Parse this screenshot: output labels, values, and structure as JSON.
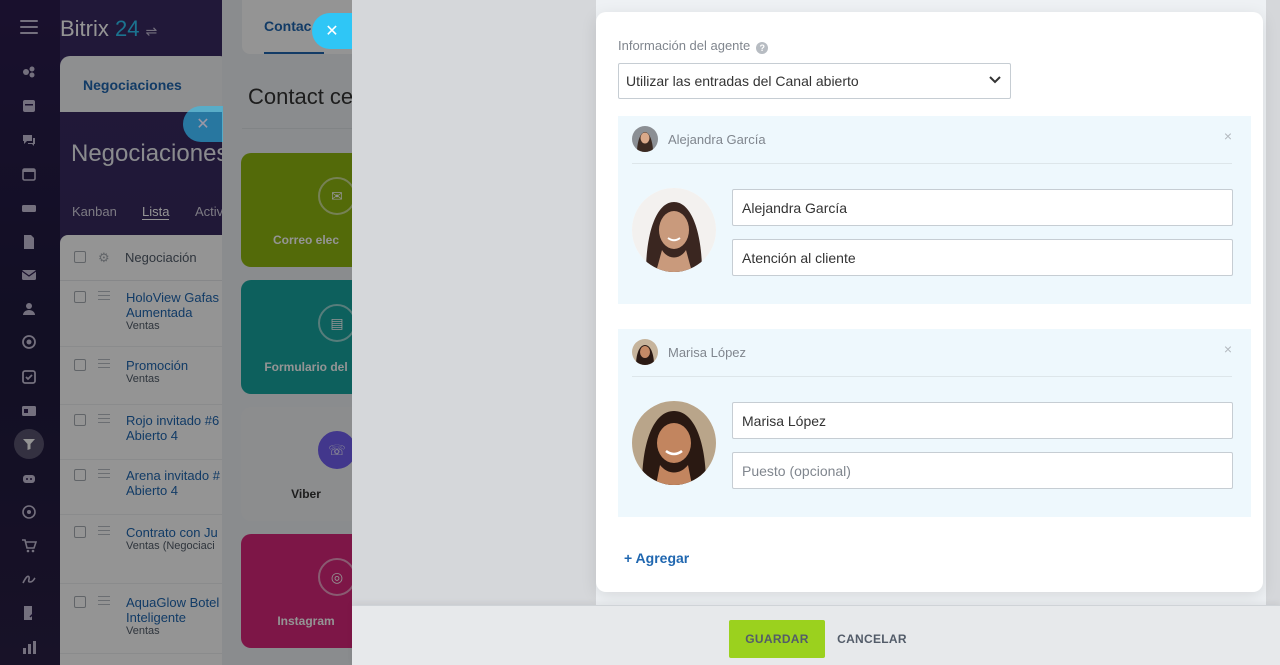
{
  "app": {
    "brand": "Bitrix",
    "brand_number": "24",
    "deals_tab": "Negociaciones",
    "deals_title": "Negociaciones",
    "views": [
      "Kanban",
      "Lista",
      "Activ"
    ],
    "grid_header": "Negociación",
    "rows": [
      {
        "name": "HoloView Gafas Aumentada",
        "stage": "Ventas"
      },
      {
        "name": "Promoción",
        "stage": "Ventas"
      },
      {
        "name": "Rojo invitado #6",
        "stage": "Abierto 4"
      },
      {
        "name": "Arena invitado #",
        "stage": "Abierto 4"
      },
      {
        "name": "Contrato con Ju",
        "stage": "Ventas (Negociaci"
      },
      {
        "name": "AquaGlow Botel Inteligente",
        "stage": "Ventas"
      }
    ]
  },
  "contact_center": {
    "tab": "Contac",
    "title": "Contact ce",
    "tiles": [
      {
        "label": "Correo elec",
        "color": "#8fb710",
        "icon": "mail-icon"
      },
      {
        "label": "Formulario del",
        "color": "#17a6a0",
        "icon": "form-icon"
      },
      {
        "label": "Viber",
        "color": "#f1f3f5",
        "icon": "viber-icon"
      },
      {
        "label": "Instagram",
        "color": "#d8267a",
        "icon": "instagram-icon"
      }
    ]
  },
  "popup": {
    "agent_info_label": "Información del agente",
    "agent_mode": "Utilizar las entradas del Canal abierto",
    "agents": [
      {
        "header": "Alejandra García",
        "name": "Alejandra García",
        "position": "Atención al cliente",
        "position_placeholder": "Puesto (opcional)"
      },
      {
        "header": "Marisa López",
        "name": "Marisa López",
        "position": "",
        "position_placeholder": "Puesto (opcional)"
      }
    ],
    "add_label": "+ Agregar"
  },
  "footer": {
    "save": "GUARDAR",
    "cancel": "CANCELAR"
  },
  "colors": {
    "accent": "#2fc6f6",
    "link": "#2067b0",
    "save_button": "#9bd11e"
  }
}
